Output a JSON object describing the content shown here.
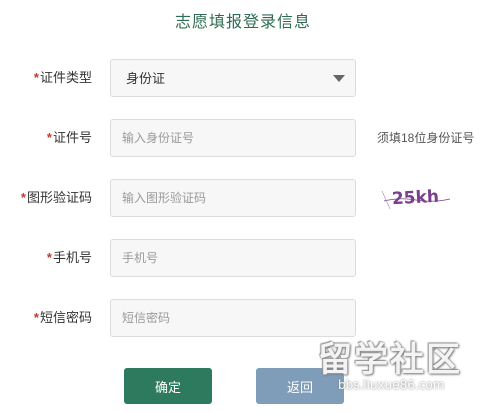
{
  "page": {
    "title": "志愿填报登录信息"
  },
  "form": {
    "required_mark": "*",
    "id_type": {
      "label": "证件类型",
      "value": "身份证"
    },
    "id_number": {
      "label": "证件号",
      "placeholder": "输入身份证号",
      "hint": "须填18位身份证号"
    },
    "captcha": {
      "label": "图形验证码",
      "placeholder": "输入图形验证码",
      "image_text": "25kh"
    },
    "phone": {
      "label": "手机号",
      "placeholder": "手机号"
    },
    "sms_code": {
      "label": "短信密码",
      "placeholder": "短信密码"
    }
  },
  "buttons": {
    "confirm": "确定",
    "back": "返回"
  },
  "watermark": {
    "main": "留学社区",
    "sub": "bbs.liuxue86.com"
  },
  "colors": {
    "title": "#2f6b52",
    "confirm_button": "#2e7a5e",
    "back_button": "#7f9db9",
    "required": "#c0392b",
    "captcha": "#7a3f8a"
  }
}
